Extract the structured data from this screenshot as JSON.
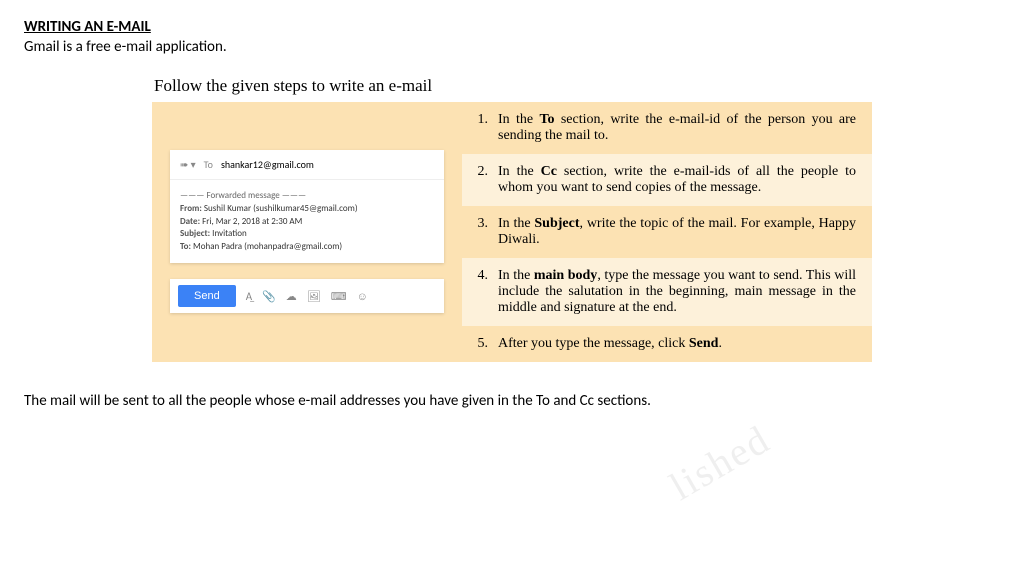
{
  "header": {
    "title": "WRITING AN E-MAIL",
    "subtitle": "Gmail is a free e-mail application."
  },
  "figure": {
    "caption": "Follow the given steps to write an e-mail",
    "compose": {
      "arrow": "➠ ▾",
      "to_label": "To",
      "to_value": "shankar12@gmail.com",
      "fwd_divider": "——— Forwarded message ———",
      "from_label": "From:",
      "from_value": "Sushil Kumar (sushilkumar45@gmail.com)",
      "date_label": "Date:",
      "date_value": "Fri, Mar 2, 2018 at 2:30 AM",
      "subject_label": "Subject:",
      "subject_value": "Invitation",
      "to2_label": "To:",
      "to2_value": "Mohan Padra (mohanpadra@gmail.com)",
      "send_label": "Send"
    },
    "steps": [
      {
        "num": "1.",
        "html": "In the <b>To</b> section, write the e-mail-id of the person you are sending the mail to."
      },
      {
        "num": "2.",
        "html": "In the <b>Cc</b> section, write the e-mail-ids of all the people to whom you want to send copies of the message."
      },
      {
        "num": "3.",
        "html": "In the <b>Subject</b>, write the topic of the mail. For example, Happy Diwali."
      },
      {
        "num": "4.",
        "html": "In the <b>main body</b>, type the message you want to send. This will include the salutation in the beginning, main message in the middle and signature at the end."
      },
      {
        "num": "5.",
        "html": "After you type the message, click <b>Send</b>."
      }
    ]
  },
  "footer": "The mail will be sent to all the people whose e-mail addresses you have given in the To and Cc sections.",
  "watermark": "lished"
}
